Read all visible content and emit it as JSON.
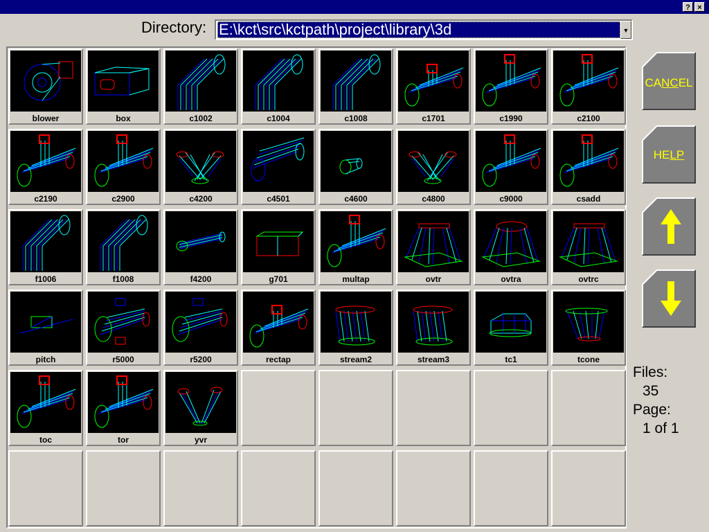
{
  "titlebar": {
    "help_button": "?",
    "close_button": "×"
  },
  "directory": {
    "label": "Directory:",
    "path": "E:\\kct\\src\\kctpath\\project\\library\\3d",
    "dropdown_glyph": "▼"
  },
  "files": [
    {
      "name": "blower",
      "shape": "blower"
    },
    {
      "name": "box",
      "shape": "box"
    },
    {
      "name": "c1002",
      "shape": "elbow"
    },
    {
      "name": "c1004",
      "shape": "elbow"
    },
    {
      "name": "c1008",
      "shape": "elbow"
    },
    {
      "name": "c1701",
      "shape": "tee-small"
    },
    {
      "name": "c1990",
      "shape": "tee"
    },
    {
      "name": "c2100",
      "shape": "tee"
    },
    {
      "name": "c2190",
      "shape": "tee"
    },
    {
      "name": "c2900",
      "shape": "tee"
    },
    {
      "name": "c4200",
      "shape": "wye"
    },
    {
      "name": "c4501",
      "shape": "cylinder"
    },
    {
      "name": "c4600",
      "shape": "small-cyl"
    },
    {
      "name": "c4800",
      "shape": "wye"
    },
    {
      "name": "c9000",
      "shape": "tee"
    },
    {
      "name": "csadd",
      "shape": "tee"
    },
    {
      "name": "f1006",
      "shape": "elbow"
    },
    {
      "name": "f1008",
      "shape": "elbow"
    },
    {
      "name": "f4200",
      "shape": "flat-cyl"
    },
    {
      "name": "g701",
      "shape": "rect-box"
    },
    {
      "name": "multap",
      "shape": "tee"
    },
    {
      "name": "ovtr",
      "shape": "transition"
    },
    {
      "name": "ovtra",
      "shape": "transition-oval"
    },
    {
      "name": "ovtrc",
      "shape": "transition"
    },
    {
      "name": "pitch",
      "shape": "pitch"
    },
    {
      "name": "r5000",
      "shape": "cross"
    },
    {
      "name": "r5200",
      "shape": "cross-top"
    },
    {
      "name": "rectap",
      "shape": "tee-small"
    },
    {
      "name": "stream2",
      "shape": "stream"
    },
    {
      "name": "stream3",
      "shape": "stream"
    },
    {
      "name": "tc1",
      "shape": "tc"
    },
    {
      "name": "tcone",
      "shape": "cone"
    },
    {
      "name": "toc",
      "shape": "tee"
    },
    {
      "name": "tor",
      "shape": "tee"
    },
    {
      "name": "yvr",
      "shape": "yvr"
    }
  ],
  "grid": {
    "columns": 8,
    "rows": 6
  },
  "buttons": {
    "cancel": "CANCEL",
    "help": "HELP",
    "up_icon": "arrow-up-icon",
    "down_icon": "arrow-down-icon"
  },
  "info": {
    "files_label": "Files:",
    "files_count": "35",
    "page_label": "Page:",
    "page_value": "1 of 1"
  },
  "colors": {
    "titlebar": "#000080",
    "background": "#d4d0c8",
    "selection": "#000080",
    "button_text": "#ffff00",
    "wire_cyan": "#00ffff",
    "wire_blue": "#0000ff",
    "wire_green": "#00ff00",
    "wire_red": "#ff0000"
  }
}
